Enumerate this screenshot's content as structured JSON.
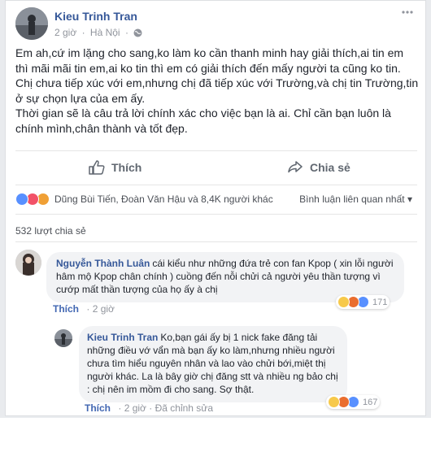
{
  "post": {
    "author": "Kieu Trinh Tran",
    "time": "2 giờ",
    "separator": "·",
    "location": "Hà Nội",
    "separator2": "·",
    "more_icon": "more-horizontal-icon",
    "paragraphs": [
      "Em ah,cứ im lặng cho sang,ko làm ko cần thanh minh hay giải thích,ai tin em thì mãi mãi tin em,ai ko tin thì em có giải thích đến mấy người ta cũng ko tin.",
      "Chị chưa tiếp xúc với em,nhưng chị đã tiếp xúc với Trường,và chị tin Trường,tin ở sự chọn lựa của em ấy.",
      "Thời gian sẽ là câu trả lời chính xác cho việc bạn là ai. Chỉ cần bạn luôn là chính mình,chân thành và tốt đẹp."
    ]
  },
  "actions": {
    "like_label": "Thích",
    "share_label": "Chia sẻ"
  },
  "reactions": {
    "summary": "Dũng Bùi Tiến, Đoàn Văn Hậu và 8,4K người khác",
    "related_label": "Bình luận liên quan nhất",
    "related_caret": "▾"
  },
  "shares": {
    "label": "532 lượt chia sẻ"
  },
  "comments": [
    {
      "name": "Nguyễn Thành Luân",
      "text": "cái kiểu như những đứa trẻ con fan Kpop ( xin lỗi người hâm mộ Kpop chân chính ) cuồng đến nỗi chửi cả người yêu thần tượng vì cướp mất thần tượng của họ ấy à chị",
      "like_label": "Thích",
      "time": "2 giờ",
      "reaction_count": "171"
    },
    {
      "name": "Kieu Trinh Tran",
      "text": "Ko,bạn gái ấy bị 1 nick fake đăng tải những điều vớ vẩn mà bạn ấy ko làm,nhưng nhiều người chưa tìm hiểu nguyên nhân và lao vào chửi bới,miệt thị người khác. La là bây giờ chị đăng stt và nhiều ng bảo chị : chị nên im mồm đi cho sang. Sợ thật.",
      "like_label": "Thích",
      "time": "2 giờ",
      "edited": "Đã chỉnh sửa",
      "reaction_count": "167"
    }
  ],
  "colors": {
    "link": "#365899",
    "action_blue": "#4267b2",
    "muted": "#90949c"
  }
}
